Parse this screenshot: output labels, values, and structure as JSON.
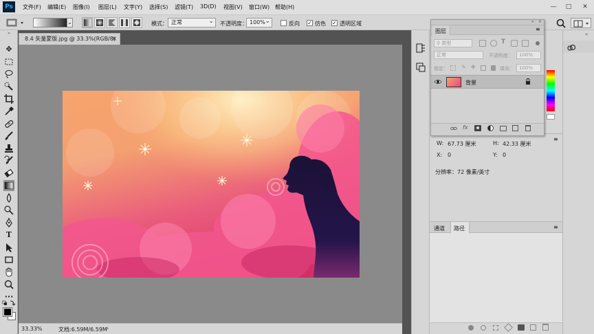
{
  "app": {
    "logo": "Ps"
  },
  "menu": [
    "文件(F)",
    "编辑(E)",
    "图像(I)",
    "图层(L)",
    "文字(Y)",
    "选择(S)",
    "滤镜(T)",
    "3D(D)",
    "视图(V)",
    "窗口(W)",
    "帮助(H)"
  ],
  "window_controls": {
    "minimize": "—",
    "maximize": "□",
    "close": "✕"
  },
  "options": {
    "mode_label": "模式：",
    "mode_value": "正常",
    "opacity_label": "不透明度：",
    "opacity_value": "100%",
    "reverse_label": "反向",
    "dither_label": "仿色",
    "transparency_label": "透明区域",
    "dither_checked": "✓",
    "transparency_checked": "✓"
  },
  "document": {
    "tab_title": "8.4 矢量蒙版.jpg @ 33.3%(RGB/8)",
    "tab_close": "×",
    "zoom": "33.33%",
    "doc_size": "文档:6.59M/6.59M"
  },
  "layers_panel": {
    "title": "图层",
    "kind_placeholder": "类型",
    "blend_mode": "正常",
    "opacity_label": "不透明度：",
    "opacity_value": "100%",
    "lock_label": "锁定：",
    "fill_label": "填充：",
    "fill_value": "100%",
    "layers": [
      {
        "name": "背景",
        "visible": true,
        "locked": true
      }
    ],
    "footer_icons": [
      "link-icon",
      "fx-icon",
      "mask-icon",
      "adjustment-icon",
      "folder-icon",
      "new-layer-icon",
      "trash-icon"
    ],
    "fx_label": "fx"
  },
  "info_panel": {
    "w_label": "W:",
    "w_value": "67.73 厘米",
    "h_label": "H:",
    "h_value": "42.33 厘米",
    "x_label": "X:",
    "x_value": "0",
    "y_label": "Y:",
    "y_value": "0",
    "resolution": "分辨率：72 像素/英寸"
  },
  "bottom_panel": {
    "tabs": [
      "通道",
      "路径"
    ]
  },
  "colors": {
    "accent_blue": "#31a8ff",
    "ps_dark": "#001e36",
    "canvas_bg": "#8a8a8a",
    "silhouette": "#1a1338"
  }
}
